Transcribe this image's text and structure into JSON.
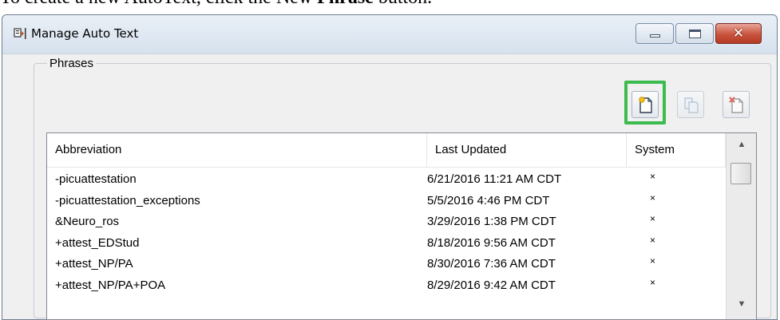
{
  "instruction": {
    "prefix": "To create a new AutoText, click the New ",
    "bold": "Phrase",
    "suffix": " button."
  },
  "window": {
    "title": "Manage Auto Text",
    "close_glyph": "✕"
  },
  "group": {
    "label": "Phrases"
  },
  "toolbar": {
    "new_icon": "new-phrase-icon",
    "copy_icon": "copy-phrase-icon",
    "delete_icon": "delete-phrase-icon",
    "highlight_color": "#3dbb4e"
  },
  "list": {
    "columns": [
      "Abbreviation",
      "Last Updated",
      "System"
    ],
    "rows": [
      {
        "abbreviation": "-picuattestation",
        "last_updated": "6/21/2016 11:21 AM CDT",
        "system": "×"
      },
      {
        "abbreviation": "-picuattestation_exceptions",
        "last_updated": "5/5/2016 4:46 PM CDT",
        "system": "×"
      },
      {
        "abbreviation": "&Neuro_ros",
        "last_updated": "3/29/2016 1:38 PM CDT",
        "system": "×"
      },
      {
        "abbreviation": "+attest_EDStud",
        "last_updated": "8/18/2016 9:56 AM CDT",
        "system": "×"
      },
      {
        "abbreviation": "+attest_NP/PA",
        "last_updated": "8/30/2016 7:36 AM CDT",
        "system": "×"
      },
      {
        "abbreviation": "+attest_NP/PA+POA",
        "last_updated": "8/29/2016 9:42 AM CDT",
        "system": "×"
      }
    ]
  },
  "scrollbar": {
    "up_glyph": "▲",
    "down_glyph": "▼"
  }
}
